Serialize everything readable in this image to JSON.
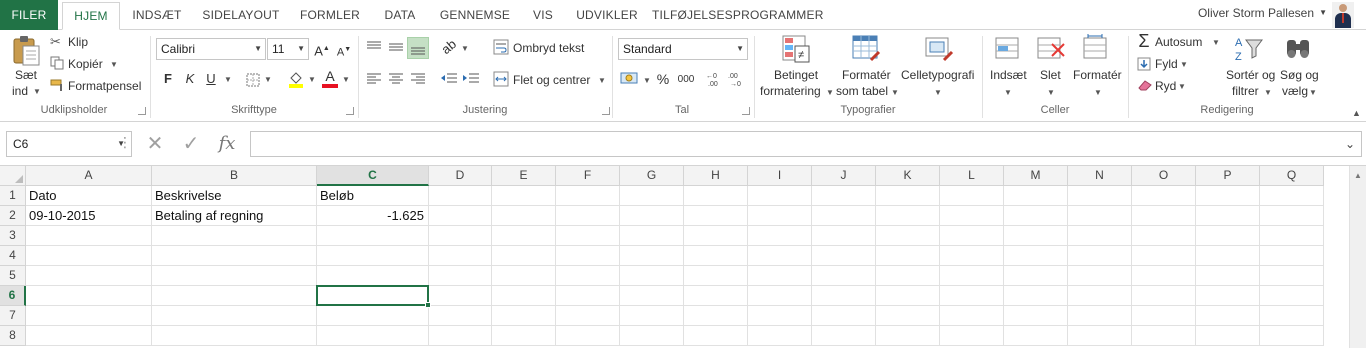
{
  "tabs": [
    {
      "label": "FILER",
      "kind": "file"
    },
    {
      "label": "HJEM",
      "kind": "active"
    },
    {
      "label": "INDSÆT"
    },
    {
      "label": "SIDELAYOUT"
    },
    {
      "label": "FORMLER"
    },
    {
      "label": "DATA"
    },
    {
      "label": "GENNEMSE"
    },
    {
      "label": "VIS"
    },
    {
      "label": "UDVIKLER"
    },
    {
      "label": "TILFØJELSESPROGRAMMER"
    }
  ],
  "user": {
    "name": "Oliver Storm Pallesen"
  },
  "ribbon": {
    "clipboard": {
      "group_label": "Udklipsholder",
      "paste_line1": "Sæt",
      "paste_line2": "ind",
      "cut": "Klip",
      "copy": "Kopiér",
      "format_painter": "Formatpensel"
    },
    "font": {
      "group_label": "Skrifttype",
      "font_name": "Calibri",
      "font_size": "11",
      "bold": "F",
      "italic": "K",
      "underline": "U"
    },
    "alignment": {
      "group_label": "Justering",
      "wrap_text": "Ombryd tekst",
      "merge_center": "Flet og centrer"
    },
    "number": {
      "group_label": "Tal",
      "format": "Standard",
      "percent": "%",
      "thousands": "000"
    },
    "styles": {
      "group_label": "Typografier",
      "conditional_line1": "Betinget",
      "conditional_line2": "formatering",
      "format_table_line1": "Formatér",
      "format_table_line2": "som tabel",
      "cell_styles": "Celletypografi"
    },
    "cells": {
      "group_label": "Celler",
      "insert": "Indsæt",
      "delete": "Slet",
      "format": "Formatér"
    },
    "editing": {
      "group_label": "Redigering",
      "autosum": "Autosum",
      "fill": "Fyld",
      "clear": "Ryd",
      "sort_line1": "Sortér og",
      "sort_line2": "filtrer",
      "find_line1": "Søg og",
      "find_line2": "vælg"
    }
  },
  "formula_bar": {
    "name_box": "C6",
    "fx": "fx",
    "formula": ""
  },
  "sheet": {
    "columns": [
      "A",
      "B",
      "C",
      "D",
      "E",
      "F",
      "G",
      "H",
      "I",
      "J",
      "K",
      "L",
      "M",
      "N",
      "O",
      "P",
      "Q"
    ],
    "selected_column": "C",
    "rows": [
      "1",
      "2",
      "3",
      "4",
      "5",
      "6",
      "7",
      "8"
    ],
    "selected_row": "6",
    "cells": {
      "A1": "Dato",
      "B1": "Beskrivelse",
      "C1": "Beløb",
      "A2": "09-10-2015",
      "B2": "Betaling af regning",
      "C2": "-1.625"
    },
    "active_cell": "C6"
  },
  "colors": {
    "accent": "#217346",
    "highlight_yellow": "#ffff00",
    "font_red": "#e81123"
  }
}
